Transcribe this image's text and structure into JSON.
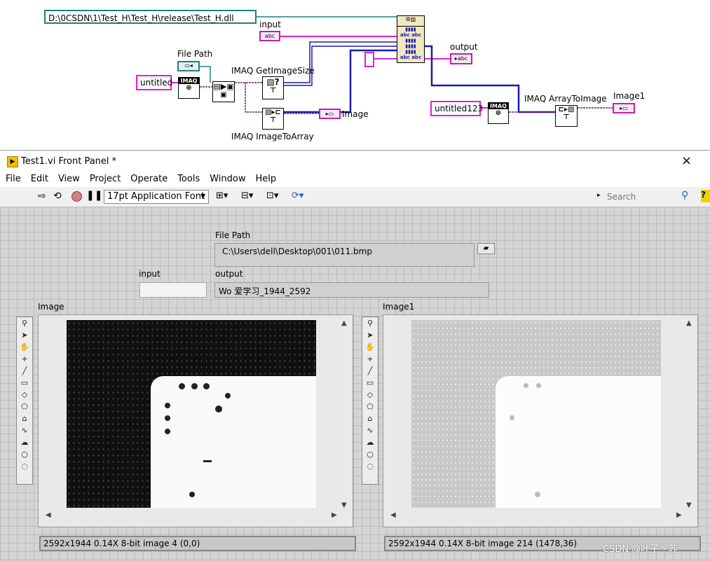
{
  "block_diagram": {
    "dll_path": "D:\\0CSDN\\1\\Test_H\\Test_H\\release\\Test_H.dll",
    "labels": {
      "input": "input",
      "output": "output",
      "file_path": "File Path",
      "get_image_size": "IMAQ GetImageSize",
      "image_to_array": "IMAQ ImageToArray",
      "image": "Image",
      "array_to_image": "IMAQ ArrayToImage",
      "image1": "Image1"
    },
    "constants": {
      "untitled": "untitled",
      "untitled123": "untitled123"
    }
  },
  "window": {
    "title": "Test1.vi Front Panel *",
    "close_glyph": "×",
    "menu": [
      "File",
      "Edit",
      "View",
      "Project",
      "Operate",
      "Tools",
      "Window",
      "Help"
    ],
    "font_select": "17pt Application Font",
    "search_placeholder": "Search"
  },
  "front_panel": {
    "file_path_label": "File Path",
    "file_path_value": "C:\\Users\\dell\\Desktop\\001\\011.bmp",
    "input_label": "input",
    "input_value": "",
    "output_label": "output",
    "output_value": "Wo 爱学习_1944_2592",
    "image_label": "Image",
    "image1_label": "Image1",
    "image_status": "2592x1944 0.14X 8-bit image 4     (0,0)",
    "image1_status": "2592x1944 0.14X 8-bit image 214     (1478,36)"
  },
  "watermark": "CSDN @叶子丶苏",
  "colors": {
    "path_wire": "#1f7f7f",
    "string_wire": "#e020d0",
    "image_wire": "#7a1f6a",
    "blue_wire": "#1a1ab0"
  }
}
